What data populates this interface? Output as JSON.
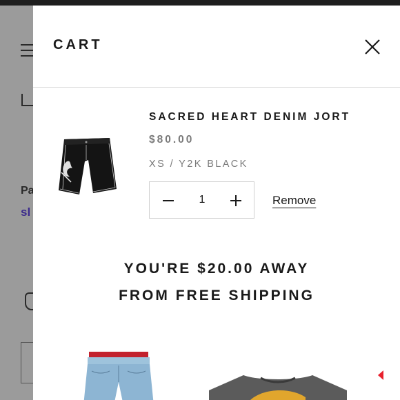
{
  "background_page": {
    "text_pa": "Pa",
    "text_sl": "sl"
  },
  "cart": {
    "title": "CART",
    "item": {
      "name": "SACRED HEART DENIM JORT",
      "price": "$80.00",
      "variant": "XS / Y2K BLACK",
      "quantity": "1",
      "remove_label": "Remove"
    },
    "shipping_message_line1": "YOU'RE $20.00 AWAY",
    "shipping_message_line2": "FROM FREE SHIPPING"
  },
  "icons": {
    "close": "close-icon",
    "minus": "minus-icon",
    "plus": "plus-icon",
    "menu": "hamburger-menu-icon",
    "arrow": "chevron-right-icon"
  },
  "colors": {
    "overlay": "#8f8f8f",
    "drawer_bg": "#ffffff",
    "text": "#1a1a1a",
    "muted": "#7a7a7a",
    "accent_arrow": "#e8212e",
    "bg_link": "#3b2a8c"
  }
}
